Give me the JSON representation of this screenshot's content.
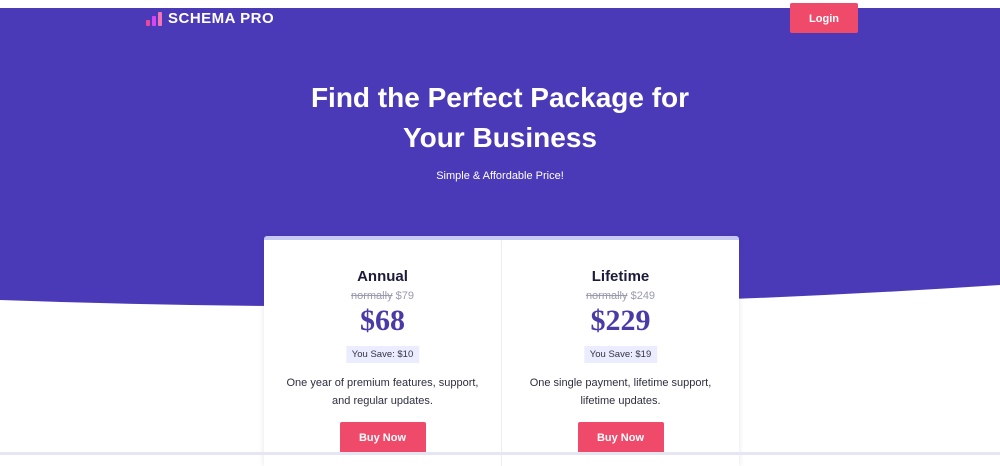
{
  "brand": {
    "name": "SCHEMA PRO"
  },
  "header": {
    "login_label": "Login"
  },
  "hero": {
    "title_line1": "Find the Perfect Package for",
    "title_line2": "Your Business",
    "subtitle": "Simple & Affordable Price!"
  },
  "plans": [
    {
      "name": "Annual",
      "normally_label": "normally",
      "normal_price": "$79",
      "price": "$68",
      "save_text": "You Save:  $10",
      "desc_line1": "One year of premium features, support,",
      "desc_line2": "and regular updates.",
      "button_label": "Buy Now"
    },
    {
      "name": "Lifetime",
      "normally_label": "normally",
      "normal_price": "$249",
      "price": "$229",
      "save_text": "You Save:  $19",
      "desc_line1": "One single payment, lifetime support,",
      "desc_line2": "lifetime updates.",
      "button_label": "Buy Now"
    }
  ],
  "colors": {
    "hero_bg": "#4b3ab8",
    "accent_button": "#ef4a6a",
    "price_text": "#4a3aa8"
  },
  "icons": {
    "logo": "schema-pro-logo-icon"
  }
}
